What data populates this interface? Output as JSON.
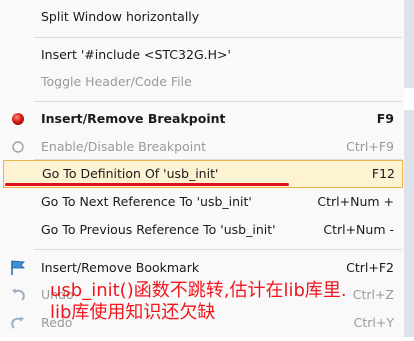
{
  "menu": {
    "items": [
      {
        "label": "Split Window horizontally",
        "shortcut": ""
      },
      {
        "label": "Insert '#include <STC32G.H>'",
        "shortcut": ""
      },
      {
        "label": "Toggle Header/Code File",
        "shortcut": ""
      },
      {
        "label": "Insert/Remove Breakpoint",
        "shortcut": "F9"
      },
      {
        "label": "Enable/Disable Breakpoint",
        "shortcut": "Ctrl+F9"
      },
      {
        "label": "Go To Definition Of 'usb_init'",
        "shortcut": "F12"
      },
      {
        "label": "Go To Next Reference To 'usb_init'",
        "shortcut": "Ctrl+Num +"
      },
      {
        "label": "Go To Previous Reference To 'usb_init'",
        "shortcut": "Ctrl+Num -"
      },
      {
        "label": "Insert/Remove Bookmark",
        "shortcut": "Ctrl+F2"
      },
      {
        "label": "Undo",
        "shortcut": "Ctrl+Z"
      },
      {
        "label": "Redo",
        "shortcut": "Ctrl+Y"
      }
    ],
    "highlight_color": "#fdf2d2",
    "highlight_border": "#e9b64a"
  },
  "annotation": {
    "line1": "usb_init()函数不跳转,估计在lib库里.",
    "line2": "lib库使用知识还欠缺",
    "color": "#f0161e"
  }
}
